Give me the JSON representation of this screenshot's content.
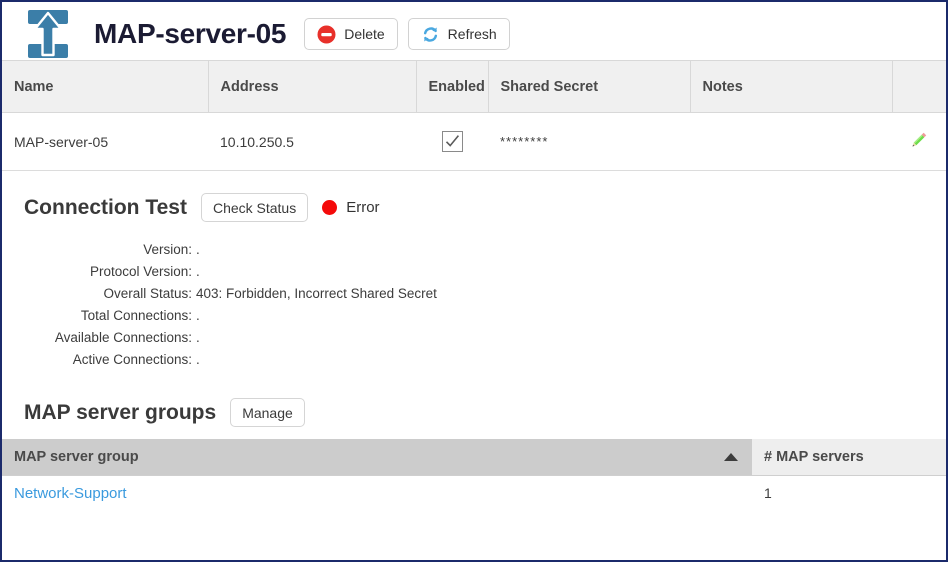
{
  "header": {
    "icon": "server-upload-icon",
    "title": "MAP-server-05",
    "buttons": [
      {
        "label": "Delete",
        "icon": "delete-circle-icon",
        "color": "#e8302a"
      },
      {
        "label": "Refresh",
        "icon": "refresh-arrows-icon",
        "color": "#4aa8e0"
      }
    ]
  },
  "servers_table": {
    "columns": [
      "Name",
      "Address",
      "Enabled",
      "Shared Secret",
      "Notes",
      ""
    ],
    "rows": [
      {
        "name": "MAP-server-05",
        "address": "10.10.250.5",
        "enabled": true,
        "shared_secret": "********",
        "notes": "",
        "edit_icon": "pencil-edit-icon"
      }
    ]
  },
  "connection_test": {
    "title": "Connection Test",
    "check_button": "Check Status",
    "status_label": "Error",
    "status_color": "#f40a0a",
    "details": [
      {
        "label": "Version:",
        "value": "."
      },
      {
        "label": "Protocol Version:",
        "value": "."
      },
      {
        "label": "Overall Status:",
        "value": "403: Forbidden, Incorrect Shared Secret"
      },
      {
        "label": "Total Connections:",
        "value": "."
      },
      {
        "label": "Available Connections:",
        "value": "."
      },
      {
        "label": "Active Connections:",
        "value": "."
      }
    ]
  },
  "server_groups": {
    "title": "MAP server groups",
    "manage_button": "Manage",
    "columns": {
      "group": "MAP server group",
      "count": "# MAP servers"
    },
    "sort": {
      "column": "MAP server group",
      "direction": "ascending",
      "icon": "caret-up-icon"
    },
    "rows": [
      {
        "group": "Network-Support",
        "count": "1"
      }
    ]
  }
}
